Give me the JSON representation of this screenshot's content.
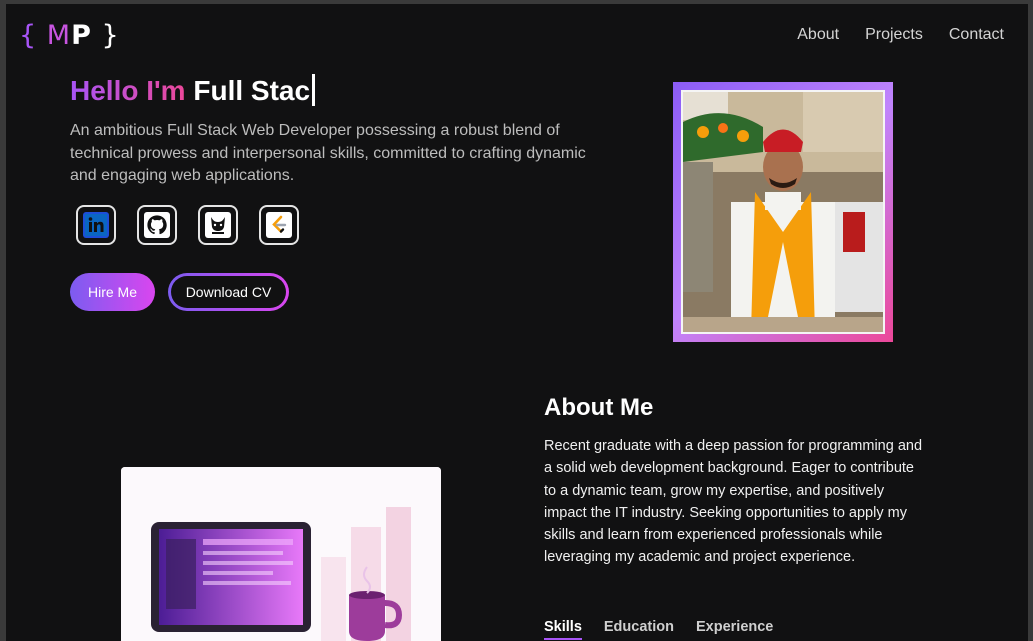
{
  "logo": {
    "open": "{",
    "m": "M",
    "p": "P",
    "close": "}"
  },
  "nav": {
    "items": [
      "About",
      "Projects",
      "Contact"
    ]
  },
  "hero": {
    "greeting": "Hello I'm",
    "typed": "Full Stac",
    "description": "An ambitious Full Stack Web Developer possessing a robust blend of technical prowess and interpersonal skills, committed to crafting dynamic and engaging web applications.",
    "hire_label": "Hire Me",
    "cv_label": "Download CV"
  },
  "socials": [
    "linkedin-icon",
    "github-icon",
    "codechef-icon",
    "leetcode-icon"
  ],
  "about": {
    "title": "About Me",
    "description": "Recent graduate with a deep passion for programming and a solid web development background. Eager to contribute to a dynamic team, grow my expertise, and positively impact the IT industry. Seeking opportunities to apply my skills and learn from experienced professionals while leveraging my academic and project experience.",
    "tabs": [
      "Skills",
      "Education",
      "Experience"
    ],
    "active_tab": "Skills"
  },
  "colors": {
    "accent_purple": "#a855f7",
    "accent_pink": "#ec4899",
    "background": "#111112"
  }
}
